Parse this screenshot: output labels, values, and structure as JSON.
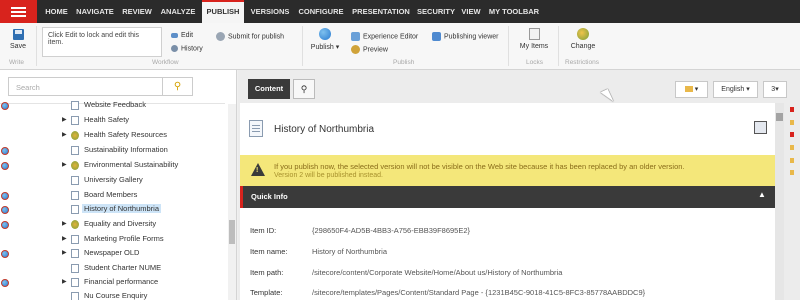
{
  "nav": {
    "tabs": [
      {
        "label": "HOME"
      },
      {
        "label": "NAVIGATE"
      },
      {
        "label": "REVIEW"
      },
      {
        "label": "ANALYZE"
      },
      {
        "label": "PUBLISH"
      },
      {
        "label": "VERSIONS"
      },
      {
        "label": "CONFIGURE"
      },
      {
        "label": "PRESENTATION"
      },
      {
        "label": "SECURITY"
      },
      {
        "label": "VIEW"
      },
      {
        "label": "MY TOOLBAR"
      }
    ],
    "active": "PUBLISH"
  },
  "ribbon": {
    "save": "Save",
    "write_group": "Write",
    "edit_note": "Click Edit to lock and edit this item.",
    "edit": "Edit",
    "history": "History",
    "submit_for_publish": "Submit for publish",
    "workflow_group": "Workflow",
    "publish": "Publish",
    "experience_editor": "Experience Editor",
    "preview": "Preview",
    "publishing_viewer": "Publishing viewer",
    "publish_group": "Publish",
    "my_items": "My Items",
    "locks_group": "Locks",
    "change": "Change",
    "restrictions_group": "Restrictions"
  },
  "search": {
    "placeholder": "Search"
  },
  "tree": {
    "items": [
      {
        "label": "Website Feedback",
        "expander": "",
        "globe": true
      },
      {
        "label": "Health Safety",
        "expander": "▶",
        "globe": false
      },
      {
        "label": "Health Safety Resources",
        "expander": "▶",
        "globe": false
      },
      {
        "label": "Sustainability Information",
        "expander": "",
        "globe": true
      },
      {
        "label": "Environmental Sustainability",
        "expander": "▶",
        "globe": true
      },
      {
        "label": "University Gallery",
        "expander": "",
        "globe": false
      },
      {
        "label": "Board Members",
        "expander": "",
        "globe": true
      },
      {
        "label": "History of Northumbria",
        "expander": "",
        "globe": true,
        "selected": true
      },
      {
        "label": "Equality and Diversity",
        "expander": "▶",
        "globe": true
      },
      {
        "label": "Marketing Profile Forms",
        "expander": "▶",
        "globe": false
      },
      {
        "label": "Newspaper OLD",
        "expander": "▶",
        "globe": true
      },
      {
        "label": "Student Charter NUME",
        "expander": "",
        "globe": false
      },
      {
        "label": "Financial performance",
        "expander": "▶",
        "globe": true
      },
      {
        "label": "Nu Course Enquiry",
        "expander": "",
        "globe": false
      }
    ]
  },
  "content": {
    "tab_content": "Content",
    "language": "English",
    "version": "3",
    "item_title": "History of Northumbria",
    "warning_line1": "If you publish now, the selected version will not be visible on the Web site because it has been replaced by an older version.",
    "warning_line2": "Version 2 will be published instead.",
    "quick_info": "Quick Info",
    "fields": [
      {
        "label": "Item ID:",
        "value": "{298650F4-AD5B-4BB3-A756-EBB39F8695E2}"
      },
      {
        "label": "Item name:",
        "value": "History of Northumbria"
      },
      {
        "label": "Item path:",
        "value": "/sitecore/content/Corporate Website/Home/About us/History of Northumbria"
      },
      {
        "label": "Template:",
        "value": "/sitecore/templates/Pages/Content/Standard Page - {1231B45C-9018-41C5-8FC3-85778AABDDC9}"
      }
    ]
  },
  "colors": {
    "accent": "#d8231d",
    "topbar": "#2b2b2b",
    "warning": "#f4e77a",
    "selected": "#cde4f7"
  }
}
